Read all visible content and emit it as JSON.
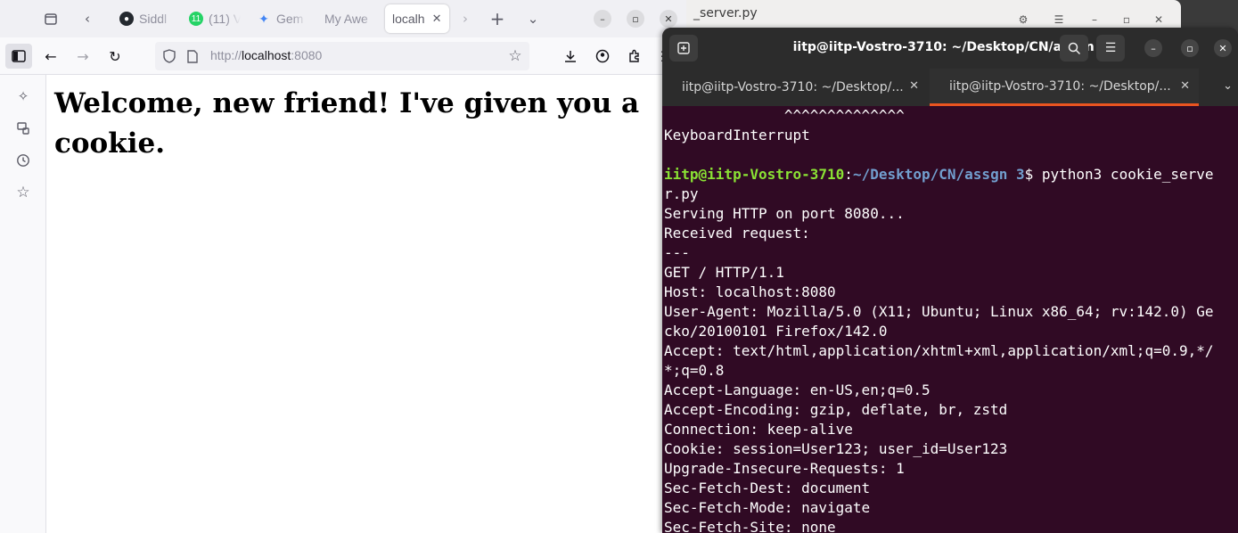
{
  "background_window": {
    "title": "_server.py"
  },
  "firefox": {
    "tabs": [
      {
        "label": "Siddl",
        "icon": "github-icon"
      },
      {
        "label": "(11) V",
        "icon": "whatsapp-icon",
        "badge": "11"
      },
      {
        "label": "Gem",
        "icon": "gemini-icon"
      },
      {
        "label": "My Awe",
        "icon": "page-icon"
      },
      {
        "label": "localh",
        "icon": "page-icon",
        "active": true
      }
    ],
    "url": {
      "prefix": "http://",
      "host": "localhost",
      "port": ":8080"
    },
    "page_heading": "Welcome, new friend! I've given you a cookie."
  },
  "terminal": {
    "title": "iitp@iitp-Vostro-3710: ~/Desktop/CN/assgn 3",
    "tabs": [
      {
        "label": "iitp@iitp-Vostro-3710: ~/Desktop/..."
      },
      {
        "label": "iitp@iitp-Vostro-3710: ~/Desktop/...",
        "active": true
      }
    ],
    "lines": [
      "              ^^^^^^^^^^^^^^",
      "KeyboardInterrupt",
      "",
      "__PROMPT__",
      "r.py",
      "Serving HTTP on port 8080...",
      "Received request:",
      "---",
      "GET / HTTP/1.1",
      "Host: localhost:8080",
      "User-Agent: Mozilla/5.0 (X11; Ubuntu; Linux x86_64; rv:142.0) Ge",
      "cko/20100101 Firefox/142.0",
      "Accept: text/html,application/xhtml+xml,application/xml;q=0.9,*/",
      "*;q=0.8",
      "Accept-Language: en-US,en;q=0.5",
      "Accept-Encoding: gzip, deflate, br, zstd",
      "Connection: keep-alive",
      "Cookie: session=User123; user_id=User123",
      "Upgrade-Insecure-Requests: 1",
      "Sec-Fetch-Dest: document",
      "Sec-Fetch-Mode: navigate",
      "Sec-Fetch-Site: none"
    ],
    "prompt": {
      "user_host": "iitp@iitp-Vostro-3710",
      "sep": ":",
      "path": "~/Desktop/CN/assgn 3",
      "symbol": "$",
      "command": " python3 cookie_serve"
    }
  },
  "colors": {
    "terminal_bg": "#300a24",
    "prompt_user": "#8ae234",
    "prompt_path": "#729fcf",
    "tab_accent": "#e95420"
  }
}
